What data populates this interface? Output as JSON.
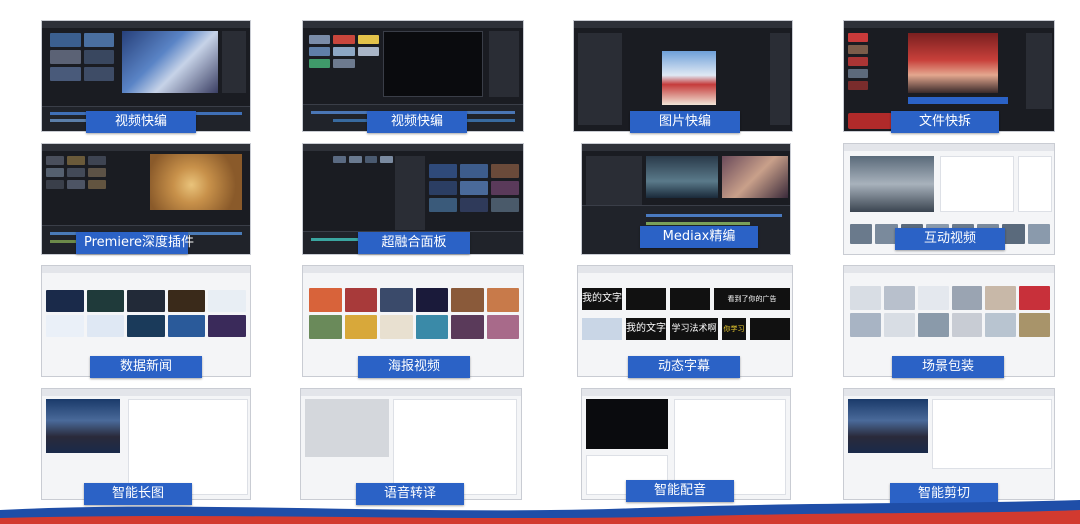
{
  "colors": {
    "label_bg": "#2b62c6",
    "label_text": "#ffffff",
    "wave_blue": "#1f4ea8",
    "wave_red": "#d23a2f",
    "dark_ui": "#1a1c22",
    "light_ui": "#f4f5f7"
  },
  "tiles": [
    {
      "label": "视频快编",
      "style": "dark",
      "content": "video-editor"
    },
    {
      "label": "视频快编",
      "style": "dark",
      "content": "video-editor"
    },
    {
      "label": "图片快编",
      "style": "dark",
      "content": "image-editor"
    },
    {
      "label": "文件快拆",
      "style": "dark",
      "content": "file-splitter"
    },
    {
      "label": "Premiere深度插件",
      "style": "dark",
      "content": "premiere-plugin"
    },
    {
      "label": "超融合面板",
      "style": "dark",
      "content": "media-panel"
    },
    {
      "label": "Mediax精编",
      "style": "dark",
      "content": "fine-editor"
    },
    {
      "label": "互动视频",
      "style": "light",
      "content": "interactive-video"
    },
    {
      "label": "数据新闻",
      "style": "light",
      "content": "data-news"
    },
    {
      "label": "海报视频",
      "style": "light",
      "content": "poster-video"
    },
    {
      "label": "动态字幕",
      "style": "light",
      "content": "dynamic-subtitles"
    },
    {
      "label": "场景包装",
      "style": "light",
      "content": "scene-packaging"
    },
    {
      "label": "智能长图",
      "style": "light",
      "content": "smart-long-image"
    },
    {
      "label": "语音转译",
      "style": "light",
      "content": "speech-transcription"
    },
    {
      "label": "智能配音",
      "style": "light",
      "content": "smart-dubbing"
    },
    {
      "label": "智能剪切",
      "style": "light",
      "content": "smart-cutting"
    }
  ],
  "subtitle_samples": [
    "我的文字",
    "看到了你的广告",
    "我的文字",
    "学习法术啊",
    "你学习"
  ]
}
